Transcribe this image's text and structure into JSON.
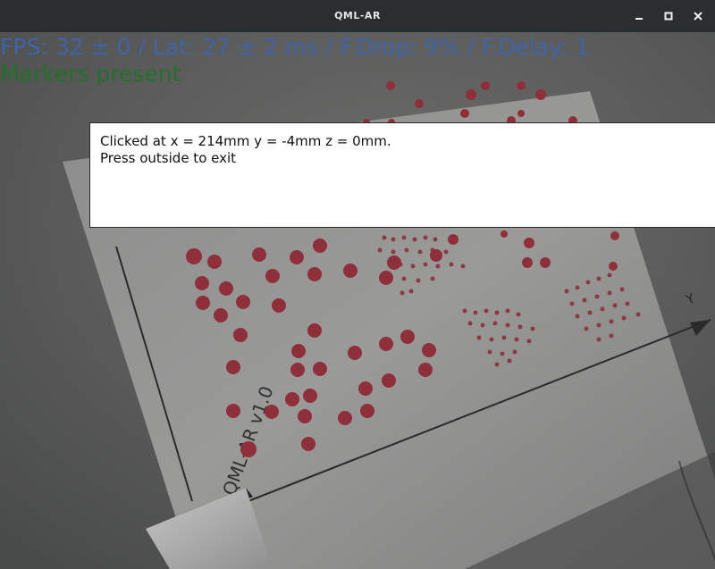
{
  "window": {
    "title": "QML-AR",
    "controls": {
      "minimize_icon": "minimize-icon",
      "maximize_icon": "maximize-icon",
      "close_icon": "close-icon"
    }
  },
  "hud": {
    "fps_line": "FPS: 32 ± 0 / Lat: 27 ± 2 ms / F.Drop: 9% / F.Delay: 1",
    "markers_line": "Markers present",
    "fps_color": "#3a67b6",
    "markers_color": "#227029"
  },
  "dialog": {
    "line1": "Clicked at x = 214mm y = -4mm z = 0mm.",
    "line2": "Press outside to exit"
  },
  "scene": {
    "sheet_label": "QML-AR v1.0",
    "axis_label": "Y",
    "marker_color": "#8e2f3a"
  }
}
